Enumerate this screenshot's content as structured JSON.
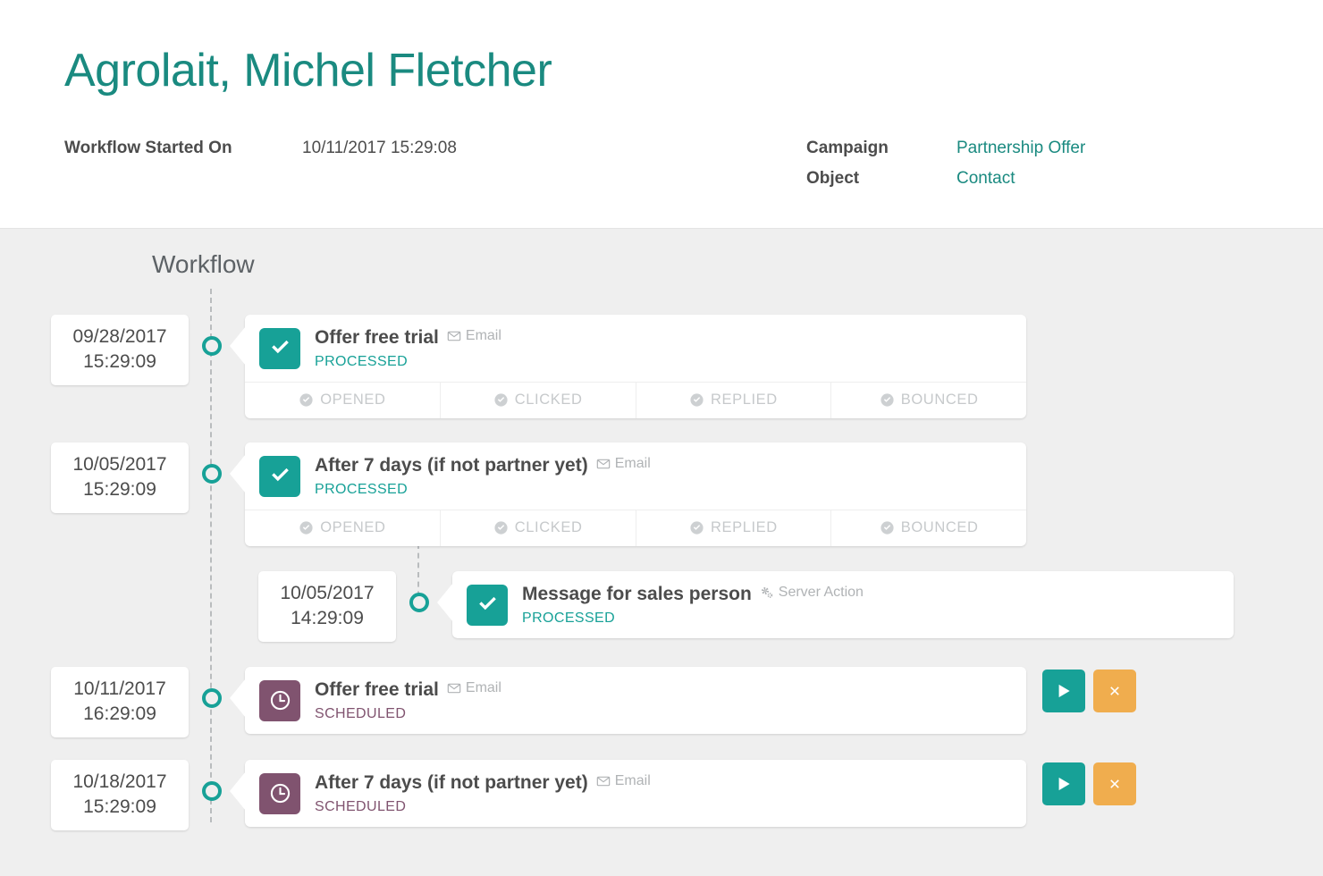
{
  "header": {
    "title": "Agrolait, Michel Fletcher",
    "started_label": "Workflow Started On",
    "started_value": "10/11/2017 15:29:08",
    "campaign_label": "Campaign",
    "campaign_value": "Partnership Offer",
    "object_label": "Object",
    "object_value": "Contact"
  },
  "colors": {
    "accent_teal": "#17a197",
    "title_teal": "#1a8a80",
    "scheduled_purple": "#80536f",
    "cancel_orange": "#f0ad4e",
    "body_grey": "#efefef",
    "text_grey": "#4c4c4c",
    "muted_grey": "#c6c9cb"
  },
  "workflow": {
    "heading": "Workflow",
    "steps": [
      {
        "date": "09/28/2017",
        "time": "15:29:09",
        "title": "Offer free trial",
        "type": "Email",
        "type_icon": "envelope-icon",
        "state": "PROCESSED",
        "state_kind": "processed",
        "icon": "check-icon",
        "nested": false,
        "has_status_strip": true,
        "statuses": [
          {
            "label": "OPENED",
            "icon": "check-circle-icon"
          },
          {
            "label": "CLICKED",
            "icon": "check-circle-icon"
          },
          {
            "label": "REPLIED",
            "icon": "check-circle-icon"
          },
          {
            "label": "BOUNCED",
            "icon": "check-circle-icon"
          }
        ],
        "actions": []
      },
      {
        "date": "10/05/2017",
        "time": "15:29:09",
        "title": "After 7 days (if not partner yet)",
        "type": "Email",
        "type_icon": "envelope-icon",
        "state": "PROCESSED",
        "state_kind": "processed",
        "icon": "check-icon",
        "nested": false,
        "has_status_strip": true,
        "statuses": [
          {
            "label": "OPENED",
            "icon": "check-circle-icon"
          },
          {
            "label": "CLICKED",
            "icon": "check-circle-icon"
          },
          {
            "label": "REPLIED",
            "icon": "check-circle-icon"
          },
          {
            "label": "BOUNCED",
            "icon": "check-circle-icon"
          }
        ],
        "actions": []
      },
      {
        "date": "10/05/2017",
        "time": "14:29:09",
        "title": "Message for sales person",
        "type": "Server Action",
        "type_icon": "cogs-icon",
        "state": "PROCESSED",
        "state_kind": "processed",
        "icon": "check-icon",
        "nested": true,
        "has_status_strip": false,
        "statuses": [],
        "actions": []
      },
      {
        "date": "10/11/2017",
        "time": "16:29:09",
        "title": "Offer free trial",
        "type": "Email",
        "type_icon": "envelope-icon",
        "state": "SCHEDULED",
        "state_kind": "scheduled",
        "icon": "clock-icon",
        "nested": false,
        "has_status_strip": false,
        "statuses": [],
        "actions": [
          {
            "name": "run-now-button",
            "icon": "play-icon",
            "kind": "play"
          },
          {
            "name": "cancel-button",
            "icon": "close-icon",
            "kind": "cancel"
          }
        ]
      },
      {
        "date": "10/18/2017",
        "time": "15:29:09",
        "title": "After 7 days (if not partner yet)",
        "type": "Email",
        "type_icon": "envelope-icon",
        "state": "SCHEDULED",
        "state_kind": "scheduled",
        "icon": "clock-icon",
        "nested": false,
        "has_status_strip": false,
        "statuses": [],
        "actions": [
          {
            "name": "run-now-button",
            "icon": "play-icon",
            "kind": "play"
          },
          {
            "name": "cancel-button",
            "icon": "close-icon",
            "kind": "cancel"
          }
        ]
      }
    ]
  }
}
